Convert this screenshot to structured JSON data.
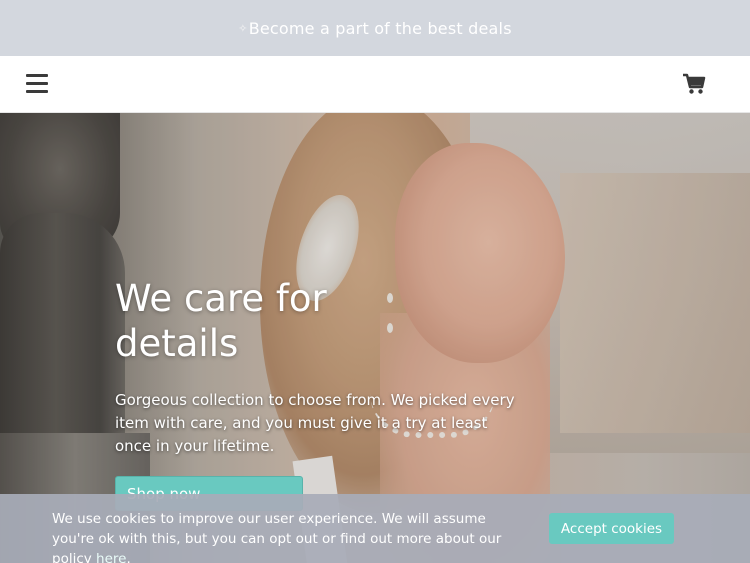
{
  "announcement": {
    "sparkle_icon": "sparkle-icon",
    "text": "Become a part of the best deals"
  },
  "navbar": {
    "menu_icon": "hamburger-menu-icon",
    "cart_icon": "shopping-cart-icon"
  },
  "hero": {
    "title": "We care for details",
    "subtitle": "Gorgeous collection to choose from. We picked every item with care, and you must give it a try at least once in your lifetime.",
    "cta_label": "Shop now"
  },
  "cookie_banner": {
    "text": "We use cookies to improve our user experience. We will assume you're ok with this, but you can opt out or find out more about our policy",
    "link_text": "here",
    "trailing": ".",
    "accept_label": "Accept cookies"
  },
  "colors": {
    "accent": "#69c9c0",
    "announcement_bg": "#d3d7de",
    "cookie_bg": "#a8acb8"
  }
}
